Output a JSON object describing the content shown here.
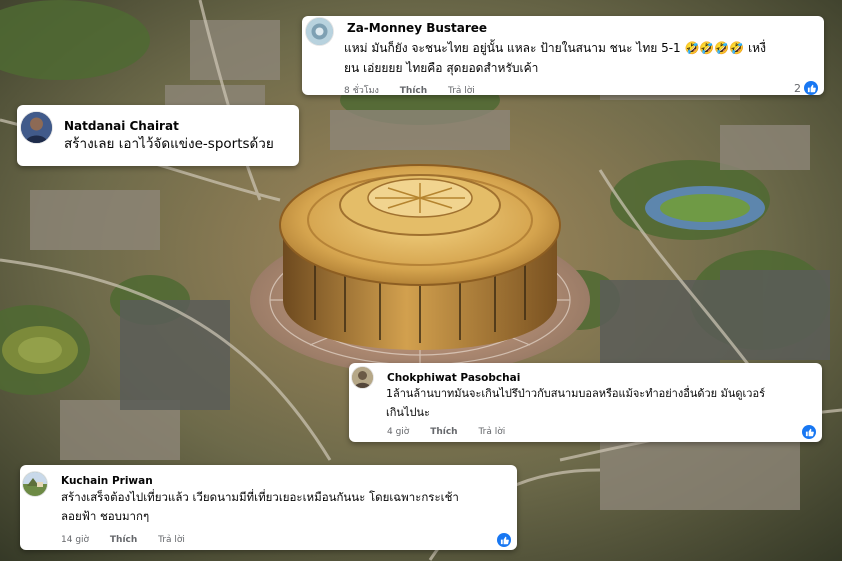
{
  "colors": {
    "accent": "#1877f2",
    "secondary_text": "#65676b",
    "primary_text": "#050505",
    "stadium_gold": "#c99a3a"
  },
  "comments": [
    {
      "author": "Za-Monney Bustaree",
      "text_lines": [
        "แหม่ มันก็ยัง จะชนะไทย อยู่นั้น แหละ ป้ายในสนาม ชนะ ไทย 5-1 🤣🤣🤣🤣 เหงื่",
        "ยน เอ่ยยยย ไทยคือ สุดยอดสำหรับเค้า"
      ],
      "time": "8 ชั่วโมง",
      "like_label": "Thích",
      "reply_label": "Trả lời",
      "reaction_count": "2",
      "reaction_icon": "like-icon"
    },
    {
      "author": "Natdanai Chairat",
      "text_lines": [
        "สร้างเลย เอาไว้จัดแข่งe-sportsด้วย"
      ],
      "reaction_icon": "none"
    },
    {
      "author": "Chokphiwat Pasobchai",
      "text_lines": [
        "1ล้านล้านบาทมันจะเกินไปรึป่าวกับสนามบอลหรือแม้จะทำอย่างอื่นด้วย มันดูเวอร์",
        "เกินไปนะ"
      ],
      "time": "4 giờ",
      "like_label": "Thích",
      "reply_label": "Trả lời",
      "reaction_count": "",
      "reaction_icon": "like-icon"
    },
    {
      "author": "Kuchain Priwan",
      "text_lines": [
        "สร้างเสร็จต้องไปเที่ยวแล้ว เวียดนามมีที่เที่ยวเยอะเหมือนกันนะ โดยเฉพาะกระเช้า",
        "ลอยฟ้า ชอบมากๆ"
      ],
      "time": "14 giờ",
      "like_label": "Thích",
      "reply_label": "Trả lời",
      "reaction_count": "",
      "reaction_icon": "like-icon"
    }
  ]
}
